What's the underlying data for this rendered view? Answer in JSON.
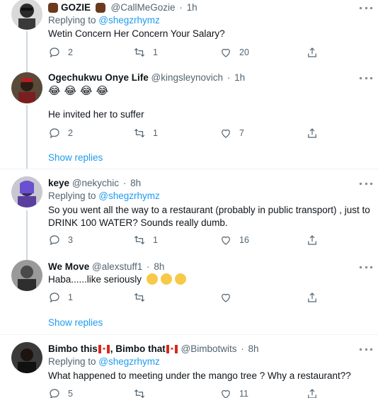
{
  "tweets": [
    {
      "name": "GOZIE",
      "handle": "@CallMeGozie",
      "time": "1h",
      "replying_prefix": "Replying to ",
      "replying_to": "@shegzrhymz",
      "text": "Wetin Concern Her Concern Your Salary?",
      "replies": "2",
      "retweets": "1",
      "likes": "20"
    },
    {
      "name": "Ogechukwu Onye Life",
      "handle": "@kingsleynovich",
      "time": "1h",
      "emoji_line": "😂😂😂😂",
      "text": "He invited her to suffer",
      "replies": "2",
      "retweets": "1",
      "likes": "7",
      "show_replies": "Show replies"
    },
    {
      "name": "keye",
      "handle": "@nekychic",
      "time": "8h",
      "replying_prefix": "Replying to ",
      "replying_to": "@shegzrhymz",
      "text": "So you went all the way to a restaurant (probably in public transport) , just to DRINK 100 WATER? Sounds really dumb.",
      "replies": "3",
      "retweets": "1",
      "likes": "16"
    },
    {
      "name": "We Move",
      "handle": "@alexstuff1",
      "time": "8h",
      "text": "Haba......like seriously",
      "replies": "1",
      "retweets": "",
      "likes": "",
      "show_replies": "Show replies"
    },
    {
      "name_part1": "Bimbo this",
      "name_part2": ", Bimbo that",
      "handle": "@Bimbotwits",
      "time": "8h",
      "replying_prefix": "Replying to ",
      "replying_to": "@shegzrhymz",
      "text": "What happened to meeting under the mango tree ? Why a restaurant??",
      "replies": "5",
      "retweets": "",
      "likes": "11"
    }
  ],
  "separator": "·",
  "colors": {
    "text": "#0f1419",
    "secondary": "#536471",
    "link": "#1d9bf0",
    "divider": "#eff3f4",
    "thread_line": "#cfd9de"
  },
  "icons": [
    "reply-icon",
    "retweet-icon",
    "like-icon",
    "share-icon",
    "more-options-icon"
  ]
}
